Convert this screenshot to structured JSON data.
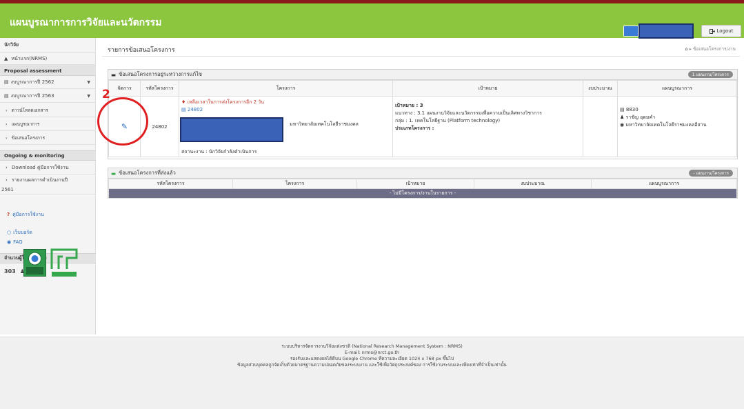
{
  "header": {
    "app_title": "แผนบูรณาการการวิจัยและนวัตกรรม",
    "logout_label": "Logout"
  },
  "sidebar": {
    "role_label": "นักวิจัย",
    "home": "หน้าแรก(NRMS)",
    "proposal_heading": "Proposal assessment",
    "budget_2562": "งบบูรณาการปี 2562",
    "budget_2563": "งบบูรณาการปี 2563",
    "download_docs": "ดาวน์โหลดเอกสาร",
    "plan": "แผนบูรณาการ",
    "proposals": "ข้อเสนอโครงการ",
    "ongoing_heading": "Ongoing & monitoring",
    "download_manual": "Download คู่มือการใช้งาน",
    "report_year": "รายงานผลการดำเนินงานปี",
    "report_year_2": "2561",
    "manual": "คู่มือการใช้งาน",
    "webboard": "เว็บบอร์ด",
    "faq": "FAQ",
    "online_heading": "จำนวนผู้ใช้ Online",
    "online_count": "303",
    "online_unit": "คน",
    "logo_left_text": "วช\nNRCT"
  },
  "main": {
    "page_title": "รายการข้อเสนอโครงการ",
    "breadcrumb": "ข้อเสนอโครงการ/งาน",
    "panel1": {
      "title": "ข้อเสนอโครงการอยู่ระหว่างการแก้ไข",
      "pill": "1 แผนงาน/โครงการ",
      "columns": [
        "จัดการ",
        "รหัสโครงการ",
        "โครงการ",
        "เป้าหมาย",
        "งบประมาณ",
        "แผนบูรณาการ"
      ],
      "row": {
        "code": "24802",
        "deadline": "เหลือเวลาในการส่งโครงการอีก 2 วัน",
        "project_code_link": "24802",
        "university": "มหาวิทยาลัยเทคโนโลยีราชมงคล",
        "status": "สถานะงาน : นักวิจัยกำลังดำเนินการ",
        "target": "เป้าหมาย : 3",
        "direction": "แนวทาง : 3.1 แผนงานวิจัยและนวัตกรรมเพื่อความเป็นเลิศทางวิชาการ",
        "group": "กลุ่ม : 1. เทคโนโลยีฐาน (Platform technology)",
        "project_type": "ประเภทโครงการ :",
        "plan_code": "8830",
        "person": "ราชัญ อุดมคำ",
        "plan_university": "มหาวิทยาลัยเทคโนโลยีราชมงคลอีสาน"
      }
    },
    "panel2": {
      "title": "ข้อเสนอโครงการที่ส่งแล้ว",
      "pill": "- แผนงาน/โครงการ",
      "columns": [
        "รหัสโครงการ",
        "โครงการ",
        "เป้าหมาย",
        "งบประมาณ",
        "แผนบูรณาการ"
      ],
      "empty": "- ไม่มีโครงการ/งานในรายการ -"
    }
  },
  "annotation": {
    "number": "2"
  },
  "footer": {
    "line1": "ระบบบริหารจัดการงานวิจัยแห่งชาติ (National Research Management System : NRMS)",
    "line2": "E-mail: nrms@nrct.go.th",
    "line3": "รองรับและแสดงผลได้ดีบน Google Chrome ที่ความละเอียด 1024 x 768 px ขึ้นไป",
    "line4": "ข้อมูลส่วนบุคคลถูกจัดเก็บด้วยมาตรฐานความปลอดภัยของระบบงาน และใช้เพื่อวัตถุประสงค์ของ การใช้งานระบบและเพียงเท่าที่จำเป็นเท่านั้น"
  },
  "colors": {
    "header_green": "#8cc63f",
    "annotation_red": "#e02020",
    "redaction_blue": "#3a63b8"
  }
}
